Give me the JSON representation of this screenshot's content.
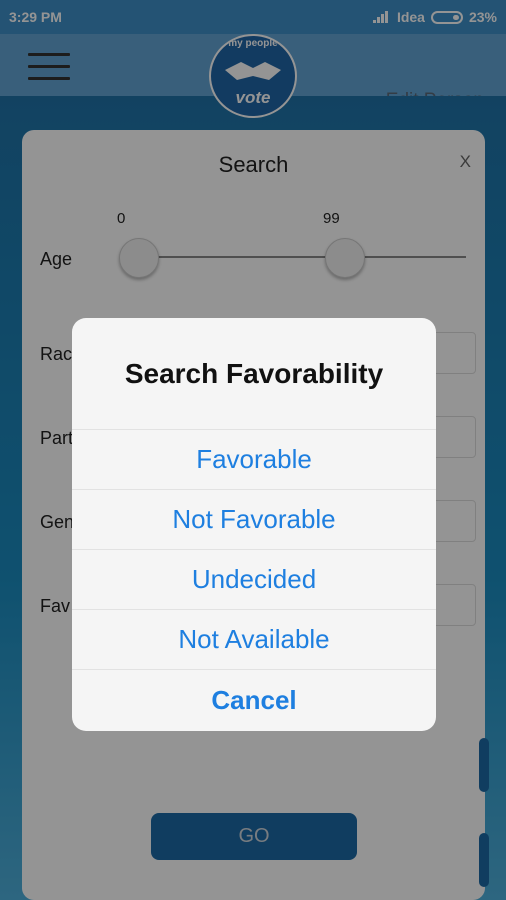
{
  "status_bar": {
    "time": "3:29 PM",
    "carrier": "Idea",
    "battery": "23%"
  },
  "app_bar": {
    "logo_top": "my people",
    "logo_bottom": "vote",
    "edit_label": "Edit Person"
  },
  "search_card": {
    "title": "Search",
    "close": "X",
    "age_label": "Age",
    "age_min": "0",
    "age_max": "99",
    "fields": [
      {
        "label": "Rac"
      },
      {
        "label": "Part"
      },
      {
        "label": "Gen"
      },
      {
        "label": "Fav"
      }
    ],
    "go_label": "GO"
  },
  "dialog": {
    "title": "Search Favorability",
    "options": [
      "Favorable",
      "Not Favorable",
      "Undecided",
      "Not Available"
    ],
    "cancel": "Cancel",
    "option_color": "#1e7fe0"
  }
}
